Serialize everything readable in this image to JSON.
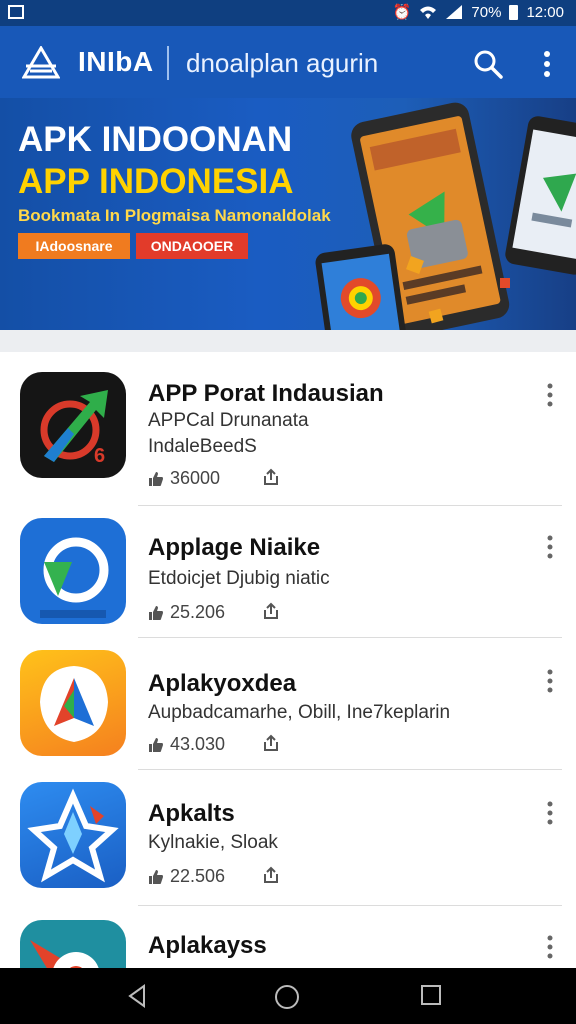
{
  "status_bar": {
    "battery": "70%",
    "time": "12:00"
  },
  "app_bar": {
    "brand": "INIbA",
    "subtitle": "dnoalplan agurin"
  },
  "banner": {
    "title_line1": "APK INDOONAN",
    "title_line2": "APP INDONESIA",
    "tagline": "Bookmata In Plogmaisa Namonaldolak",
    "button1": "IAdoosnare",
    "button2": "ONDAOOER"
  },
  "apps": [
    {
      "name": "APP Porat Indausian",
      "desc": "APPCal Drunanata",
      "desc2": "IndaleBeedS",
      "count": "36000",
      "icon": "green-arrow-app-icon"
    },
    {
      "name": "Applage Niaike",
      "desc": "Etdoicjet Djubig niatic",
      "desc2": "",
      "count": "25.206",
      "icon": "blue-refresh-app-icon"
    },
    {
      "name": "Aplakyoxdea",
      "desc": "Aupbadcamarhe, Obill, Ine7keplarin",
      "desc2": "",
      "count": "43.030",
      "icon": "orange-shield-app-icon"
    },
    {
      "name": "Apkalts",
      "desc": "Kylnakie, Sloak",
      "desc2": "",
      "count": "22.506",
      "icon": "blue-star-app-icon"
    },
    {
      "name": "Aplakayss",
      "desc": "",
      "desc2": "",
      "count": "",
      "icon": "red-compass-app-icon"
    }
  ],
  "colors": {
    "app_bar": "#1858b8",
    "status_bar": "#0f3f80",
    "banner_yellow": "#ffd200",
    "button_orange": "#f07b1f",
    "button_red": "#e23b2a"
  }
}
